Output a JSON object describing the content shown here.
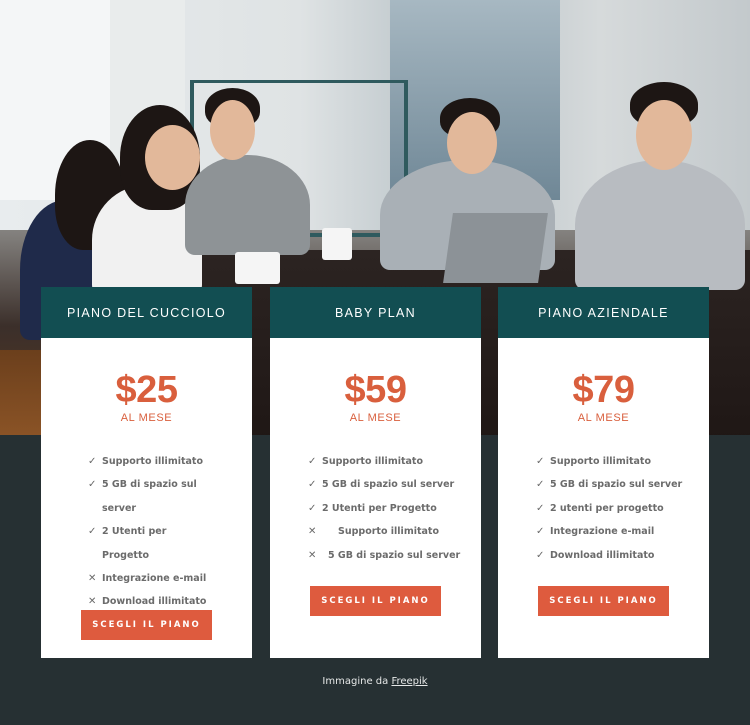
{
  "hero": {
    "image": "office-meeting-photo"
  },
  "plans": [
    {
      "name": "PIANO DEL CUCCIOLO",
      "price": "$25",
      "period": "AL MESE",
      "features": [
        {
          "icon": "check-icon",
          "glyph": "✓",
          "text": "Supporto illimitato",
          "included": true
        },
        {
          "icon": "check-icon",
          "glyph": "✓",
          "text": "5 GB di spazio sul server",
          "included": true
        },
        {
          "icon": "check-icon",
          "glyph": "✓",
          "text": "2 Utenti per Progetto",
          "included": true
        },
        {
          "icon": "cross-icon",
          "glyph": "✕",
          "text": "Integrazione e-mail",
          "included": false
        },
        {
          "icon": "cross-icon",
          "glyph": "✕",
          "text": "Download illimitato",
          "included": false
        }
      ],
      "button": "SCEGLI IL PIANO"
    },
    {
      "name": "BABY PLAN",
      "price": "$59",
      "period": "AL MESE",
      "features": [
        {
          "icon": "check-icon",
          "glyph": "✓",
          "text": "Supporto illimitato",
          "included": true
        },
        {
          "icon": "check-icon",
          "glyph": "✓",
          "text": "5 GB di spazio sul server",
          "included": true
        },
        {
          "icon": "check-icon",
          "glyph": "✓",
          "text": "2 Utenti per Progetto",
          "included": true
        },
        {
          "icon": "cross-icon",
          "glyph": "✕",
          "text": "Supporto illimitato",
          "included": false
        },
        {
          "icon": "cross-icon",
          "glyph": "✕",
          "text": "5 GB di spazio sul server",
          "included": false
        }
      ],
      "button": "SCEGLI IL PIANO"
    },
    {
      "name": "PIANO AZIENDALE",
      "price": "$79",
      "period": "AL MESE",
      "features": [
        {
          "icon": "check-icon",
          "glyph": "✓",
          "text": "Supporto illimitato",
          "included": true
        },
        {
          "icon": "check-icon",
          "glyph": "✓",
          "text": "5 GB di spazio sul server",
          "included": true
        },
        {
          "icon": "check-icon",
          "glyph": "✓",
          "text": "2 utenti per progetto",
          "included": true
        },
        {
          "icon": "check-icon",
          "glyph": "✓",
          "text": "Integrazione e-mail",
          "included": true
        },
        {
          "icon": "check-icon",
          "glyph": "✓",
          "text": "Download illimitato",
          "included": true
        }
      ],
      "button": "SCEGLI IL PIANO"
    }
  ],
  "credit": {
    "prefix": "Immagine da ",
    "link": "Freepik"
  },
  "colors": {
    "header": "#124e52",
    "accent": "#de5b3e",
    "price": "#d95f3d",
    "background": "#263033"
  }
}
